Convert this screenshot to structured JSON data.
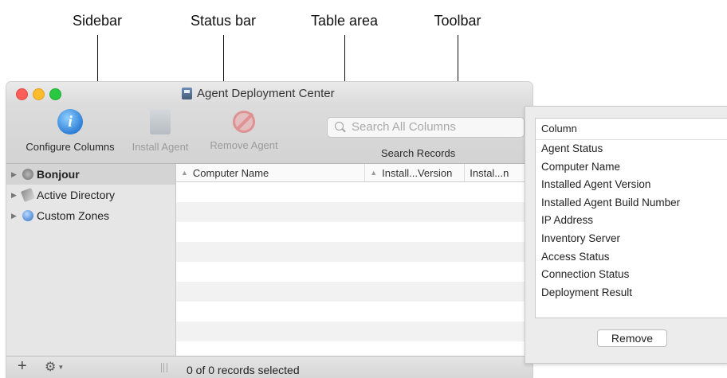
{
  "callouts": {
    "sidebar": "Sidebar",
    "status_bar": "Status bar",
    "table_area": "Table area",
    "toolbar": "Toolbar"
  },
  "window": {
    "title": "Agent Deployment Center",
    "app_icon": "agent-deployment-icon"
  },
  "toolbar": {
    "configure_label": "Configure Columns",
    "install_label": "Install Agent",
    "remove_label": "Remove Agent",
    "search_placeholder": "Search All Columns",
    "search_label": "Search Records"
  },
  "sidebar": {
    "items": [
      {
        "label": "Bonjour",
        "icon": "bonjour-icon",
        "selected": true
      },
      {
        "label": "Active Directory",
        "icon": "active-directory-icon",
        "selected": false
      },
      {
        "label": "Custom Zones",
        "icon": "custom-zones-icon",
        "selected": false
      }
    ]
  },
  "table": {
    "columns": [
      "Computer Name",
      "Install...Version",
      "Instal...n"
    ],
    "rows": []
  },
  "status": {
    "text": "0 of 0 records selected"
  },
  "panel": {
    "header": "Column",
    "items": [
      "Agent Status",
      "Computer Name",
      "Installed Agent Version",
      "Installed Agent Build Number",
      "IP Address",
      "Inventory Server",
      "Access Status",
      "Connection Status",
      "Deployment Result"
    ],
    "remove_label": "Remove"
  },
  "colors": {
    "close": "#fc5f57",
    "minimize": "#fdbc2e",
    "maximize": "#28c840"
  }
}
